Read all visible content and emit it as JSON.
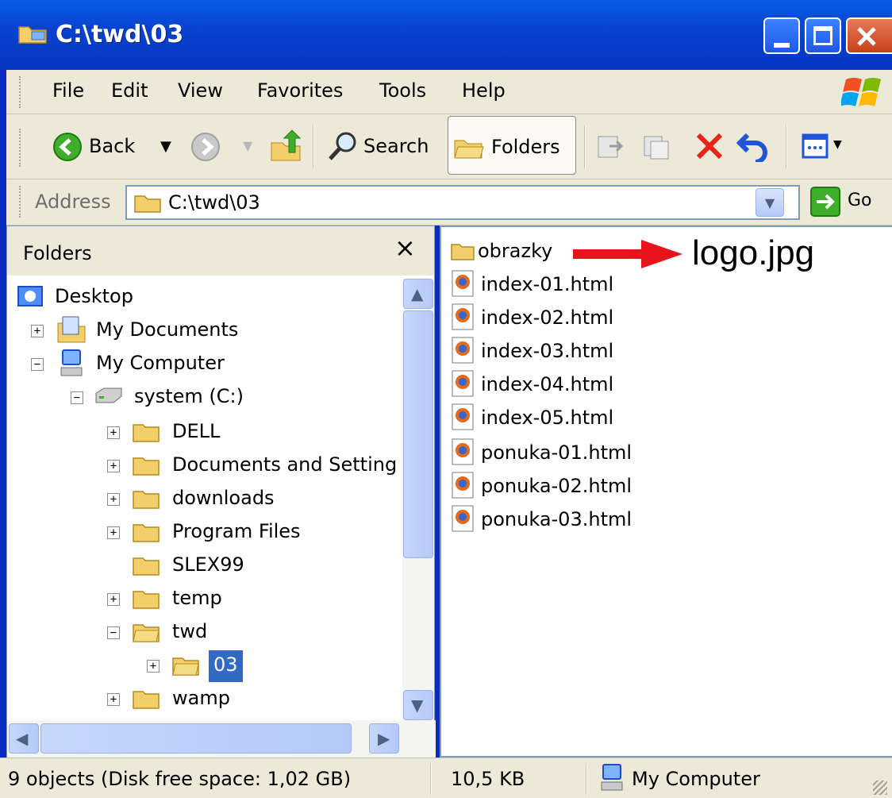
{
  "window": {
    "title": "C:\\twd\\03"
  },
  "menu": [
    {
      "label": "File"
    },
    {
      "label": "Edit"
    },
    {
      "label": "View"
    },
    {
      "label": "Favorites"
    },
    {
      "label": "Tools"
    },
    {
      "label": "Help"
    }
  ],
  "toolbar": {
    "back": "Back",
    "search": "Search",
    "folders": "Folders"
  },
  "address": {
    "label": "Address",
    "value": "C:\\twd\\03",
    "go": "Go"
  },
  "folders_pane": {
    "title": "Folders",
    "close": "×",
    "tree": [
      {
        "label": "Desktop",
        "icon": "desktop-icon",
        "depth": 0,
        "expander": ""
      },
      {
        "label": "My Documents",
        "icon": "my-documents-icon",
        "depth": 1,
        "expander": "+"
      },
      {
        "label": "My Computer",
        "icon": "my-computer-icon",
        "depth": 1,
        "expander": "−"
      },
      {
        "label": "system (C:)",
        "icon": "drive-icon",
        "depth": 2,
        "expander": "−"
      },
      {
        "label": "DELL",
        "icon": "folder-icon",
        "depth": 3,
        "expander": "+"
      },
      {
        "label": "Documents and Settings",
        "icon": "folder-icon",
        "depth": 3,
        "expander": "+"
      },
      {
        "label": "downloads",
        "icon": "folder-icon",
        "depth": 3,
        "expander": "+"
      },
      {
        "label": "Program Files",
        "icon": "folder-icon",
        "depth": 3,
        "expander": "+"
      },
      {
        "label": "SLEX99",
        "icon": "folder-icon",
        "depth": 3,
        "expander": ""
      },
      {
        "label": "temp",
        "icon": "folder-icon",
        "depth": 3,
        "expander": "+"
      },
      {
        "label": "twd",
        "icon": "folder-open-icon",
        "depth": 3,
        "expander": "−"
      },
      {
        "label": "03",
        "icon": "folder-open-icon",
        "depth": 4,
        "expander": "+",
        "selected": true
      },
      {
        "label": "wamp",
        "icon": "folder-icon",
        "depth": 3,
        "expander": "+"
      }
    ]
  },
  "files": [
    {
      "name": "obrazky",
      "type": "folder"
    },
    {
      "name": "index-01.html",
      "type": "html"
    },
    {
      "name": "index-02.html",
      "type": "html"
    },
    {
      "name": "index-03.html",
      "type": "html"
    },
    {
      "name": "index-04.html",
      "type": "html"
    },
    {
      "name": "index-05.html",
      "type": "html"
    },
    {
      "name": "ponuka-01.html",
      "type": "html"
    },
    {
      "name": "ponuka-02.html",
      "type": "html"
    },
    {
      "name": "ponuka-03.html",
      "type": "html"
    }
  ],
  "annotation": {
    "text": "logo.jpg",
    "arrow_color": "#e8141c"
  },
  "status": {
    "objects": "9 objects (Disk free space: 1,02 GB)",
    "size": "10,5 KB",
    "location": "My Computer"
  },
  "colors": {
    "selection": "#316ac5",
    "title_blue": "#0a5ce8",
    "folder_yellow": "#f3cf6b"
  }
}
